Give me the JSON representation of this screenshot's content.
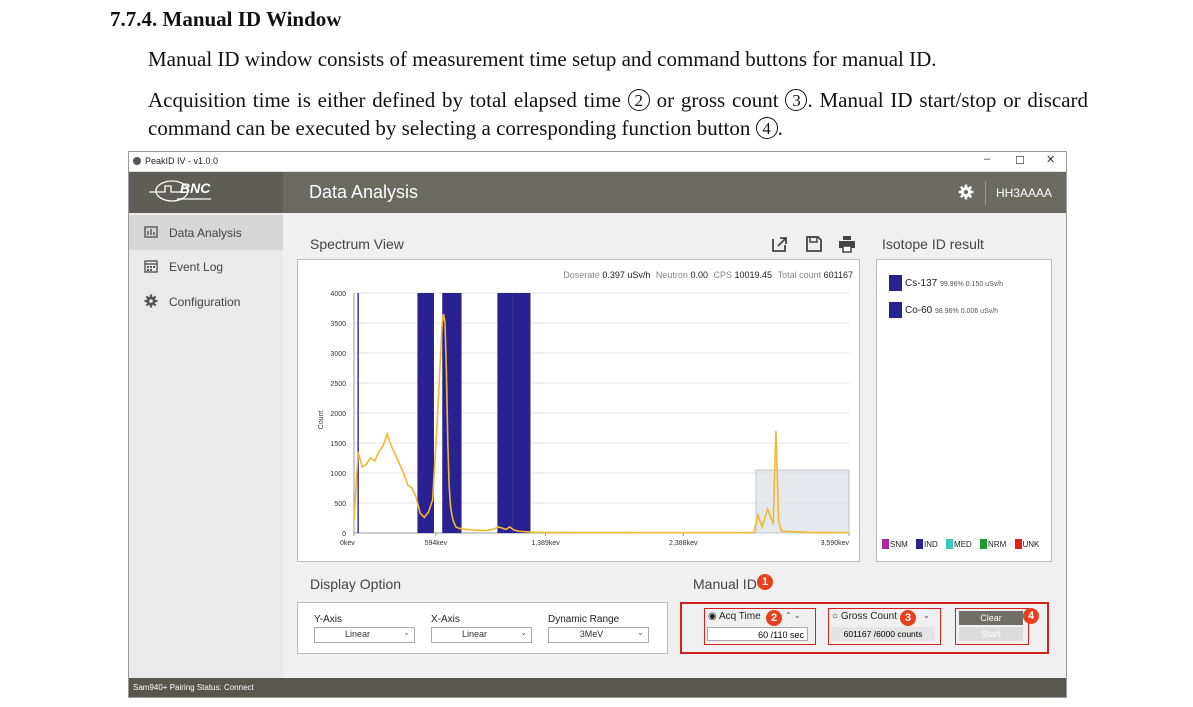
{
  "doc": {
    "heading": "7.7.4. Manual ID Window",
    "para1": "Manual ID window consists of measurement time setup and command buttons for manual ID.",
    "para2_a": "Acquisition time is either defined by total elapsed time",
    "para2_b": "or gross count",
    "para2_c": ". Manual ID start/stop or discard command can be executed by selecting a corresponding function button",
    "para2_d": ".",
    "circled": [
      "2",
      "3",
      "4"
    ]
  },
  "app": {
    "window_title": "PeakID IV - v1.0.0",
    "logo_text": "BNC",
    "header_title": "Data Analysis",
    "device_id": "HH3AAAA",
    "nav": [
      {
        "label": "Data Analysis",
        "icon": "analysis-icon",
        "active": true
      },
      {
        "label": "Event Log",
        "icon": "calendar-icon",
        "active": false
      },
      {
        "label": "Configuration",
        "icon": "gear-icon",
        "active": false
      }
    ],
    "spectrum_label": "Spectrum View",
    "isotope_label": "Isotope ID result",
    "status_text": "Sam940+ Pairing Status:  Connect"
  },
  "stats": {
    "doserate_label": "Doserate",
    "doserate_value": "0.397 uSv/h",
    "neutron_label": "Neutron",
    "neutron_value": "0.00",
    "cps_label": "CPS",
    "cps_value": "10019.45",
    "total_label": "Total count",
    "total_value": "601167"
  },
  "isotopes": [
    {
      "name": "Cs-137",
      "detail": "99.96% 0.150 uSv/h",
      "color": "#2a2190"
    },
    {
      "name": "Co-60",
      "detail": "98.96% 0.006 uSv/h",
      "color": "#2a2190"
    }
  ],
  "legend": [
    {
      "label": "SNM",
      "color": "#b0259b"
    },
    {
      "label": "IND",
      "color": "#2a2190"
    },
    {
      "label": "MED",
      "color": "#3bc9c0"
    },
    {
      "label": "NRM",
      "color": "#1e9c2a"
    },
    {
      "label": "UNK",
      "color": "#e0201b"
    }
  ],
  "display_option": {
    "label": "Display Option",
    "y_axis_label": "Y-Axis",
    "y_axis_value": "Linear",
    "x_axis_label": "X-Axis",
    "x_axis_value": "Linear",
    "dynamic_label": "Dynamic Range",
    "dynamic_value": "3MeV"
  },
  "manual_id": {
    "label": "Manual ID",
    "acq_time_label": "Acq Time",
    "acq_time_value": "60 /110 sec",
    "gross_count_label": "Gross Count",
    "gross_count_value": "601167 /6000 counts",
    "clear_label": "Clear",
    "start_label": "Start",
    "badges": [
      "1",
      "2",
      "3",
      "4"
    ]
  },
  "chart_data": {
    "type": "line",
    "title": "",
    "xlabel": "",
    "ylabel": "Count",
    "xlim": [
      0,
      3590
    ],
    "ylim": [
      0,
      4000
    ],
    "yticks": [
      "0",
      "500",
      "1000",
      "1500",
      "2000",
      "2500",
      "3000",
      "3500",
      "4000"
    ],
    "xticks": [
      {
        "label": "0kev",
        "value": 0
      },
      {
        "label": "594kev",
        "value": 594
      },
      {
        "label": "1,389kev",
        "value": 1389
      },
      {
        "label": "2,388kev",
        "value": 2388
      },
      {
        "label": "3,590kev",
        "value": 3590
      }
    ],
    "regions": [
      {
        "from": 25,
        "to": 35,
        "color": "#2a2190"
      },
      {
        "from": 460,
        "to": 580,
        "color": "#2a2190"
      },
      {
        "from": 640,
        "to": 780,
        "color": "#2a2190"
      },
      {
        "from": 1040,
        "to": 1150,
        "color": "#2a2190"
      },
      {
        "from": 1150,
        "to": 1280,
        "color": "#2a2190"
      }
    ],
    "series": [
      {
        "color": "#f0b931",
        "x": [
          0,
          30,
          60,
          90,
          120,
          150,
          180,
          210,
          240,
          270,
          300,
          330,
          360,
          390,
          420,
          450,
          480,
          510,
          540,
          570,
          600,
          620,
          640,
          650,
          660,
          670,
          680,
          690,
          700,
          710,
          720,
          740,
          760,
          780,
          820,
          860,
          900,
          950,
          1000,
          1050,
          1100,
          1130,
          1160,
          1190,
          1220,
          1250,
          1280,
          1320,
          1400,
          1600,
          1800,
          2000,
          2200,
          2400,
          2600,
          2800,
          2900,
          2930,
          2960,
          3000,
          3040,
          3060,
          3080,
          3100,
          3300,
          3590
        ],
        "y": [
          200,
          1350,
          1100,
          1150,
          1250,
          1200,
          1350,
          1450,
          1650,
          1450,
          1300,
          1150,
          1000,
          800,
          750,
          600,
          330,
          260,
          350,
          550,
          1700,
          2600,
          3500,
          3650,
          3500,
          2700,
          1500,
          800,
          450,
          300,
          200,
          100,
          80,
          70,
          60,
          50,
          45,
          40,
          55,
          100,
          60,
          100,
          50,
          30,
          25,
          20,
          15,
          12,
          10,
          8,
          8,
          6,
          5,
          5,
          5,
          5,
          10,
          300,
          100,
          400,
          150,
          1700,
          200,
          30,
          10,
          5
        ]
      }
    ]
  }
}
